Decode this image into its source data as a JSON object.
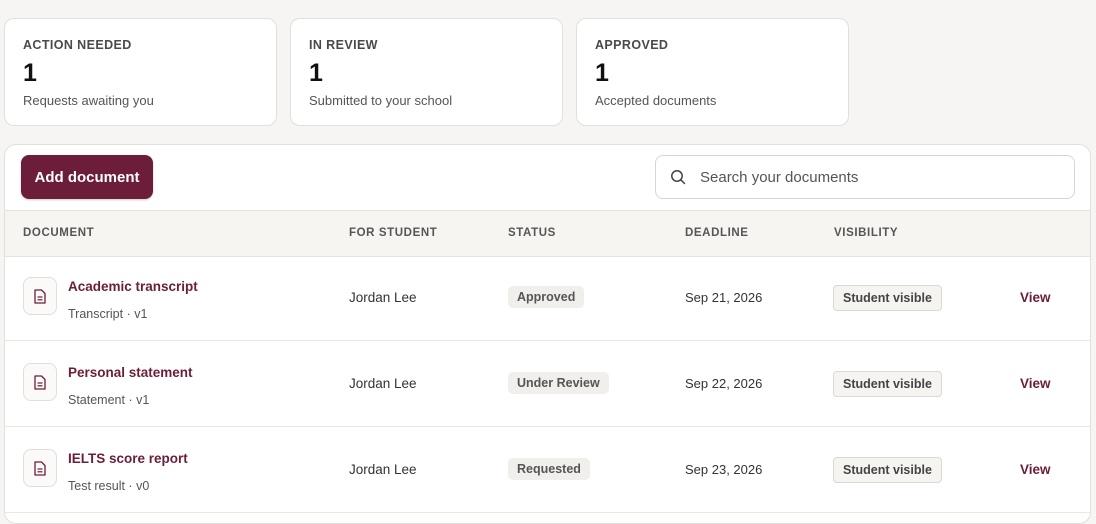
{
  "summary_cards": [
    {
      "title": "ACTION NEEDED",
      "value": "1",
      "subtitle": "Requests awaiting you"
    },
    {
      "title": "IN REVIEW",
      "value": "1",
      "subtitle": "Submitted to your school"
    },
    {
      "title": "APPROVED",
      "value": "1",
      "subtitle": "Accepted documents"
    }
  ],
  "toolbar": {
    "add_label": "Add document",
    "search_placeholder": "Search your documents",
    "search_icon": "search-icon"
  },
  "table": {
    "headers": {
      "document": "DOCUMENT",
      "student": "FOR STUDENT",
      "status": "STATUS",
      "deadline": "DEADLINE",
      "visibility": "VISIBILITY"
    },
    "rows": [
      {
        "name": "Academic transcript",
        "meta": "Transcript · v1",
        "student": "Jordan Lee",
        "status": "Approved",
        "deadline": "Sep 21, 2026",
        "visibility": "Student visible",
        "action": "View"
      },
      {
        "name": "Personal statement",
        "meta": "Statement · v1",
        "student": "Jordan Lee",
        "status": "Under Review",
        "deadline": "Sep 22, 2026",
        "visibility": "Student visible",
        "action": "View"
      },
      {
        "name": "IELTS score report",
        "meta": "Test result · v0",
        "student": "Jordan Lee",
        "status": "Requested",
        "deadline": "Sep 23, 2026",
        "visibility": "Student visible",
        "action": "View"
      }
    ]
  },
  "colors": {
    "accent": "#6b1d3a",
    "background": "#f6f5f3",
    "badge_bg": "#f1efec"
  }
}
